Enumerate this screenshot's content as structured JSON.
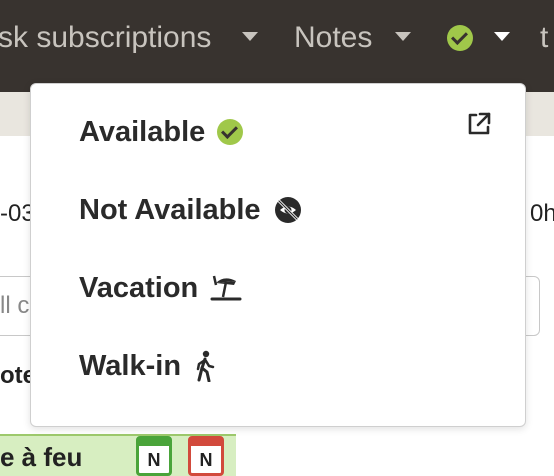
{
  "navbar": {
    "subscriptions_label": "sk subscriptions",
    "notes_label": "Notes",
    "cut_label": "t",
    "status_icon": "check-circle-icon"
  },
  "background": {
    "left_text_1": "-03",
    "right_text_1": "0h",
    "input_text": "ll c",
    "left_text_2": "ote",
    "event_text": "e à feu",
    "calendar_green_letter": "N",
    "calendar_red_letter": "N"
  },
  "dropdown": {
    "items": [
      {
        "label": "Available",
        "icon": "check-circle-icon"
      },
      {
        "label": "Not Available",
        "icon": "eye-slash-icon"
      },
      {
        "label": "Vacation",
        "icon": "umbrella-beach-icon"
      },
      {
        "label": "Walk-in",
        "icon": "person-walking-icon"
      }
    ],
    "external_link_icon": "external-link-icon"
  },
  "colors": {
    "navbar_bg": "#38332f",
    "navbar_text": "#c8c4be",
    "available_green": "#a0c84a",
    "subbar_bg": "#e9e6df"
  }
}
